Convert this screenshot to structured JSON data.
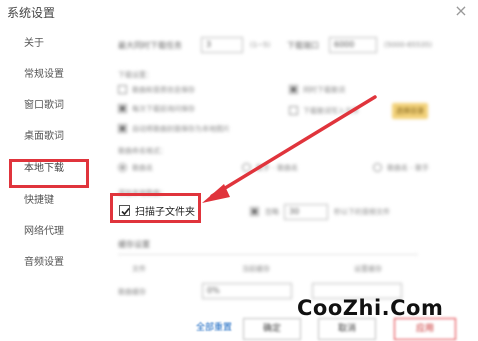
{
  "window": {
    "title": "系统设置"
  },
  "sidebar": {
    "items": [
      {
        "label": "关于"
      },
      {
        "label": "常规设置"
      },
      {
        "label": "窗口歌词"
      },
      {
        "label": "桌面歌词"
      },
      {
        "label": "本地下载"
      },
      {
        "label": "快捷键"
      },
      {
        "label": "网络代理"
      },
      {
        "label": "音频设置"
      }
    ],
    "active_index": 4
  },
  "content": {
    "max_download_label": "最大同时下载任务",
    "max_download_value": "3",
    "max_download_hint": "(1~5)",
    "port_label": "下载端口",
    "port_value": "6000",
    "port_hint": "(5000-65535)",
    "download_opts_label": "下载设置：",
    "opt1": "歌曲和音质信息保存",
    "opt2": "每次下载前询问保存",
    "opt3": "自动将歌曲封面保存为本地图片",
    "opt_r1": "同时下载歌词",
    "opt_r2": "下载歌词写入文件",
    "select_dir_btn": "选择目录",
    "file_naming_label": "歌曲命名格式：",
    "naming_1": "歌曲名",
    "naming_2": "歌手 - 歌曲名",
    "naming_3": "歌曲名 - 歌手",
    "add_local_label": "添加本地歌曲：",
    "scan_subfolder": "扫描子文件夹",
    "ignore_label": "忽略",
    "ignore_value": "30",
    "ignore_hint": "秒以下的音频文件",
    "cache_label": "缓存设置",
    "cache_col1": "文件",
    "cache_col2": "当前缓存",
    "cache_col3": "设置缓存",
    "cache_row": "歌曲缓存",
    "cache_value": "0%"
  },
  "footer": {
    "reset_all": "全部重置",
    "ok_button": "确定",
    "cancel_button": "取消",
    "apply_button": "应用"
  },
  "watermark": {
    "text": "CooZhi.Com"
  },
  "colors": {
    "highlight": "#e0343c",
    "link": "#1565c0"
  }
}
